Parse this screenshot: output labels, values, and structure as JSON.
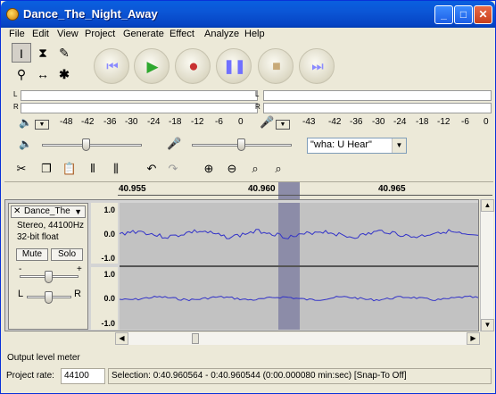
{
  "window": {
    "title": "Dance_The_Night_Away"
  },
  "menu": [
    "File",
    "Edit",
    "View",
    "Project",
    "Generate",
    "Effect",
    "Analyze",
    "Help"
  ],
  "meters": {
    "left_letter": "L",
    "right_letter": "R",
    "output_scale": [
      "-48",
      "-42",
      "-36",
      "-30",
      "-24",
      "-18",
      "-12",
      "-6",
      "0"
    ],
    "input_scale": [
      "-43",
      "-42",
      "-36",
      "-30",
      "-24",
      "-18",
      "-12",
      "-6",
      "0"
    ]
  },
  "mixer": {
    "output_volume": 0.45,
    "input_volume": 0.5,
    "input_source": "\"wha: U Hear\""
  },
  "ruler": {
    "labels": [
      "40.955",
      "40.960",
      "40.965"
    ]
  },
  "track": {
    "name": "Dance_The",
    "format_line1": "Stereo, 44100Hz",
    "format_line2": "32-bit float",
    "mute": "Mute",
    "solo": "Solo",
    "gain_minus": "-",
    "gain_plus": "+",
    "pan_left": "L",
    "pan_right": "R",
    "gain_value": 0.5,
    "pan_value": 0.5,
    "vruler_top": [
      "1.0",
      "0.0",
      "-1.0"
    ],
    "vruler_bottom": [
      "1.0",
      "0.0",
      "-1.0"
    ]
  },
  "status": {
    "hint": "Output level meter",
    "project_rate_label": "Project rate:",
    "project_rate_value": "44100",
    "selection": "Selection: 0:40.960564 - 0:40.960544 (0:00.000080 min:sec)  [Snap-To Off]"
  },
  "colors": {
    "titlebar": "#0a5fdf",
    "waveform": "#3232c8",
    "selection": "#8c8ca8",
    "play": "#2fa82f",
    "record": "#c83232",
    "transport_blue": "#6a6aff"
  }
}
